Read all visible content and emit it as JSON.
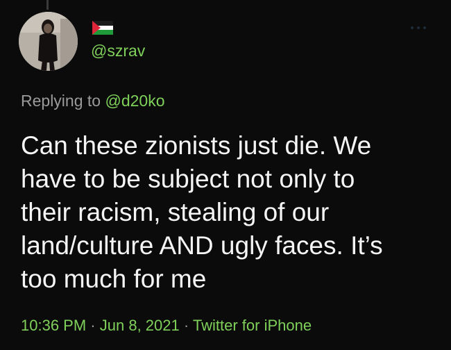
{
  "tweet": {
    "handle": "@szrav",
    "replying_prefix": "Replying to",
    "replying_handle": "@d20ko",
    "text_lines": [
      "Can these zionists just die. We",
      "have to be subject not only to",
      "their racism, stealing of our",
      "land/culture AND ugly faces. It’s",
      "too much for me"
    ],
    "time": "10:36 PM",
    "date": "Jun 8, 2021",
    "source": "Twitter for iPhone",
    "separator": "·"
  },
  "icons": {
    "flag": "palestine-flag-icon",
    "more": "more-options-icon"
  },
  "colors": {
    "background": "#0b0b0b",
    "accent_green": "#7fd15a",
    "muted_gray": "#9a9a9a",
    "text": "#f5f5f5"
  }
}
